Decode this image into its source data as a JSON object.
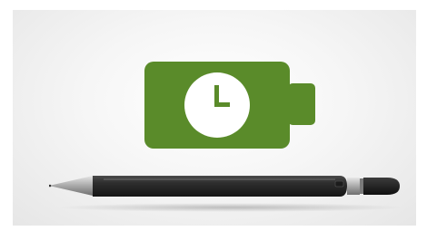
{
  "illustration": {
    "battery_icon": "battery-icon",
    "clock_icon": "clock-icon",
    "stylus_icon": "stylus-pen-icon"
  },
  "colors": {
    "battery_green": "#5a8b2a",
    "clock_face": "#ffffff",
    "clock_hands": "#5a8b2a",
    "pen_body": "#2b2b2b",
    "pen_tip_metal": "#bdbdbd",
    "background": "#f2f2f2"
  }
}
